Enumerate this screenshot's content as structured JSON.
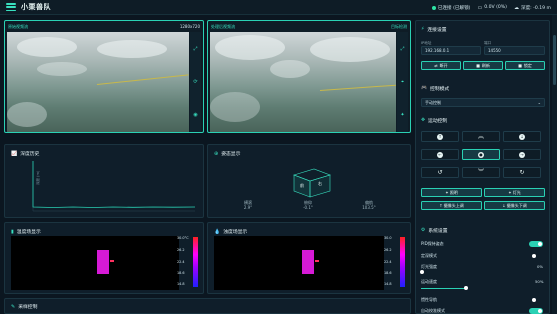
{
  "app": {
    "title": "小栗兽队"
  },
  "status": {
    "connection": "已连接 (已解锁)",
    "battery": "0.0V (0%)",
    "depth": "深度: -0.19 m"
  },
  "video_left": {
    "label": "原始视频流",
    "resolution": "1280x720"
  },
  "video_right": {
    "label": "处理后视频流",
    "badge": "目标检测"
  },
  "depth_panel": {
    "title": "深度历史",
    "ylabel": "深度 (m)"
  },
  "attitude_panel": {
    "title": "姿态显示",
    "values": [
      {
        "label": "横滚",
        "value": "2.9°"
      },
      {
        "label": "俯仰",
        "value": "-0.1°"
      },
      {
        "label": "偏航",
        "value": "103.5°"
      }
    ]
  },
  "temp_panel": {
    "title": "温度场显示",
    "scale": [
      "30.0°C",
      "26.2",
      "22.4",
      "18.6",
      "14.8"
    ]
  },
  "salinity_panel": {
    "title": "浊度场显示",
    "scale": [
      "30.0",
      "26.2",
      "22.4",
      "18.6",
      "14.8"
    ]
  },
  "sampling_panel": {
    "title": "采样控制"
  },
  "connection_settings": {
    "title": "连接设置",
    "address_label": "IP地址",
    "address_value": "192.168.0.1",
    "port_label": "端口",
    "port_value": "14550",
    "buttons": [
      "断开",
      "刷新",
      "锁定"
    ]
  },
  "control_mode": {
    "title": "控制模式",
    "selected": "手动控制"
  },
  "motion_control": {
    "title": "运动控制",
    "buttons": {
      "lights": "照明",
      "camera": "灯光",
      "up": "↑ 摄像头上调",
      "down": "↓ 摄像头下调"
    }
  },
  "system_settings": {
    "title": "系统设置",
    "items": [
      {
        "label": "PID保持姿态",
        "type": "toggle",
        "on": true
      },
      {
        "label": "定深模式",
        "type": "toggle",
        "on": false
      },
      {
        "label": "灯光强度",
        "type": "slider",
        "value": "0%"
      },
      {
        "label": "运动速度",
        "type": "slider",
        "value": "50%"
      },
      {
        "label": "惯性导航",
        "type": "toggle",
        "on": false
      },
      {
        "label": "自动校准模式",
        "type": "toggle",
        "on": true
      }
    ]
  },
  "colors": {
    "accent": "#2ad1b4",
    "background": "#0b1620",
    "panel": "#0f1e2a"
  }
}
